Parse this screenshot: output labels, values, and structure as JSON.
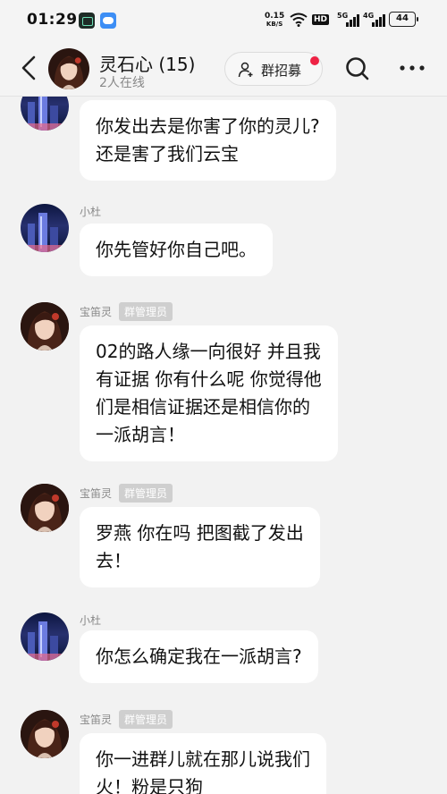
{
  "status_bar": {
    "time": "01:29",
    "net_speed_value": "0.15",
    "net_speed_unit": "KB/S",
    "hd_label": "HD",
    "sim1_label": "5G",
    "sim2_label": "4G",
    "battery": "44"
  },
  "header": {
    "group_name": "灵石心 (15)",
    "online_status": "2人在线",
    "recruit_label": "群招募"
  },
  "messages": [
    {
      "sender": "",
      "badge": "",
      "avatar": "city",
      "lines": [
        "你发出去是你害了你的灵儿?",
        "还是害了我们云宝"
      ]
    },
    {
      "sender": "小杜",
      "badge": "",
      "avatar": "city",
      "lines": [
        "你先管好你自己吧。"
      ]
    },
    {
      "sender": "宝笛灵",
      "badge": "群管理员",
      "avatar": "girl",
      "lines": [
        "02的路人缘一向很好 并且我",
        "有证据 你有什么呢 你觉得他",
        "们是相信证据还是相信你的",
        "一派胡言！"
      ]
    },
    {
      "sender": "宝笛灵",
      "badge": "群管理员",
      "avatar": "girl",
      "lines": [
        "罗燕 你在吗 把图截了发出",
        "去！"
      ]
    },
    {
      "sender": "小杜",
      "badge": "",
      "avatar": "city",
      "lines": [
        "你怎么确定我在一派胡言?"
      ]
    },
    {
      "sender": "宝笛灵",
      "badge": "群管理员",
      "avatar": "girl",
      "lines": [
        "你一进群儿就在那儿说我们",
        "火！粉是只狗"
      ]
    }
  ]
}
